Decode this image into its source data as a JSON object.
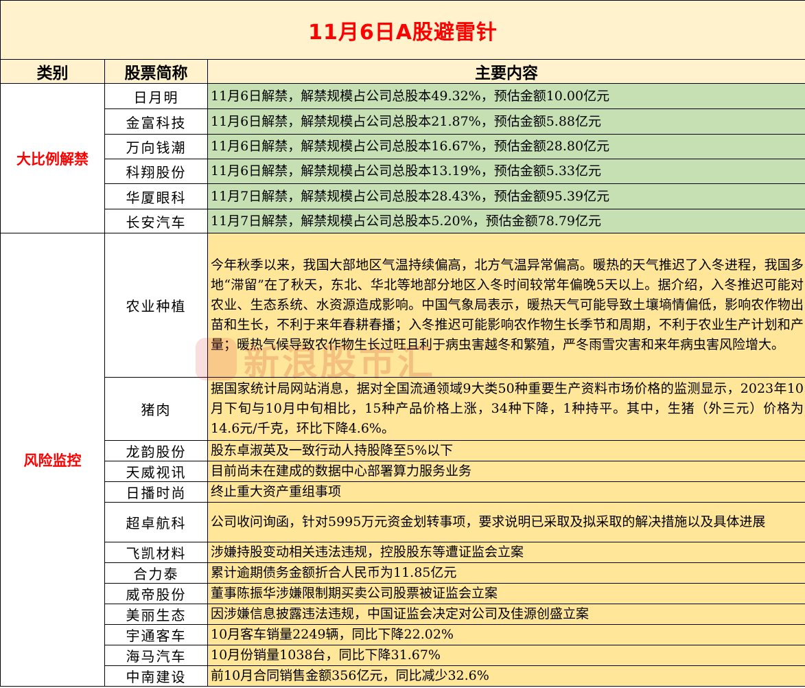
{
  "title": "11月6日A股避雷针",
  "headers": {
    "category": "类别",
    "name": "股票简称",
    "content": "主要内容"
  },
  "sections": [
    {
      "category": "大比例解禁",
      "color": "#c6e0b4",
      "rows": [
        {
          "name": "日月明",
          "content": "11月6日解禁，解禁规模占公司总股本49.32%，预估金额10.00亿元"
        },
        {
          "name": "金富科技",
          "content": "11月6日解禁，解禁规模占公司总股本21.87%，预估金额5.88亿元"
        },
        {
          "name": "万向钱潮",
          "content": "11月6日解禁，解禁规模占公司总股本16.67%，预估金额28.80亿元"
        },
        {
          "name": "科翔股份",
          "content": "11月6日解禁，解禁规模占公司总股本13.19%，预估金额5.33亿元"
        },
        {
          "name": "华厦眼科",
          "content": "11月7日解禁，解禁规模占公司总股本28.43%，预估金额95.39亿元"
        },
        {
          "name": "长安汽车",
          "content": "11月7日解禁，解禁规模占公司总股本5.20%，预估金额78.79亿元"
        }
      ]
    },
    {
      "category": "风险监控",
      "color": "#ffe699",
      "rows": [
        {
          "name": "农业种植",
          "content": "今年秋季以来，我国大部地区气温持续偏高，北方气温异常偏高。暖热的天气推迟了入冬进程，我国多地“滞留”在了秋天，东北、华北等地部分地区入冬时间较常年偏晚5天以上。据介绍，入冬推迟可能对农业、生态系统、水资源造成影响。中国气象局表示，暖热天气可能导致土壤墒情偏低，影响农作物出苗和生长，不利于来年春耕春播；入冬推迟可能影响农作物生长季节和周期，不利于农业生产计划和产量；暖热气候导致农作物生长过旺且利于病虫害越冬和繁殖，严冬雨雪灾害和来年病虫害风险增大。"
        },
        {
          "name": "猪肉",
          "content": "据国家统计局网站消息，据对全国流通领域9大类50种重要生产资料市场价格的监测显示，2023年10月下旬与10月中旬相比，15种产品价格上涨，34种下降，1种持平。其中，生猪（外三元）价格为14.6元/千克，环比下降4.6%。"
        },
        {
          "name": "龙韵股份",
          "content": "股东卓淑英及一致行动人持股降至5%以下"
        },
        {
          "name": "天威视讯",
          "content": "目前尚未在建成的数据中心部署算力服务业务"
        },
        {
          "name": "日播时尚",
          "content": "终止重大资产重组事项"
        },
        {
          "name": "超卓航科",
          "content": "公司收问询函，针对5995万元资金划转事项，要求说明已采取及拟采取的解决措施以及具体进展"
        },
        {
          "name": "飞凯材料",
          "content": "涉嫌持股变动相关违法违规，控股股东等遭证监会立案"
        },
        {
          "name": "合力泰",
          "content": "累计逾期债务金额折合人民币为11.85亿元"
        },
        {
          "name": "威帝股份",
          "content": "董事陈振华涉嫌限制期买卖公司股票被证监会立案"
        },
        {
          "name": "美丽生态",
          "content": "因涉嫌信息披露违法违规，中国证监会决定对公司及佳源创盛立案"
        },
        {
          "name": "宇通客车",
          "content": "10月客车销量2249辆，同比下降22.02%"
        },
        {
          "name": "海马汽车",
          "content": "10月份销量1038台，同比下降31.67%"
        },
        {
          "name": "中南建设",
          "content": "前10月合同销售金额356亿元，同比减少32.6%"
        }
      ]
    }
  ]
}
